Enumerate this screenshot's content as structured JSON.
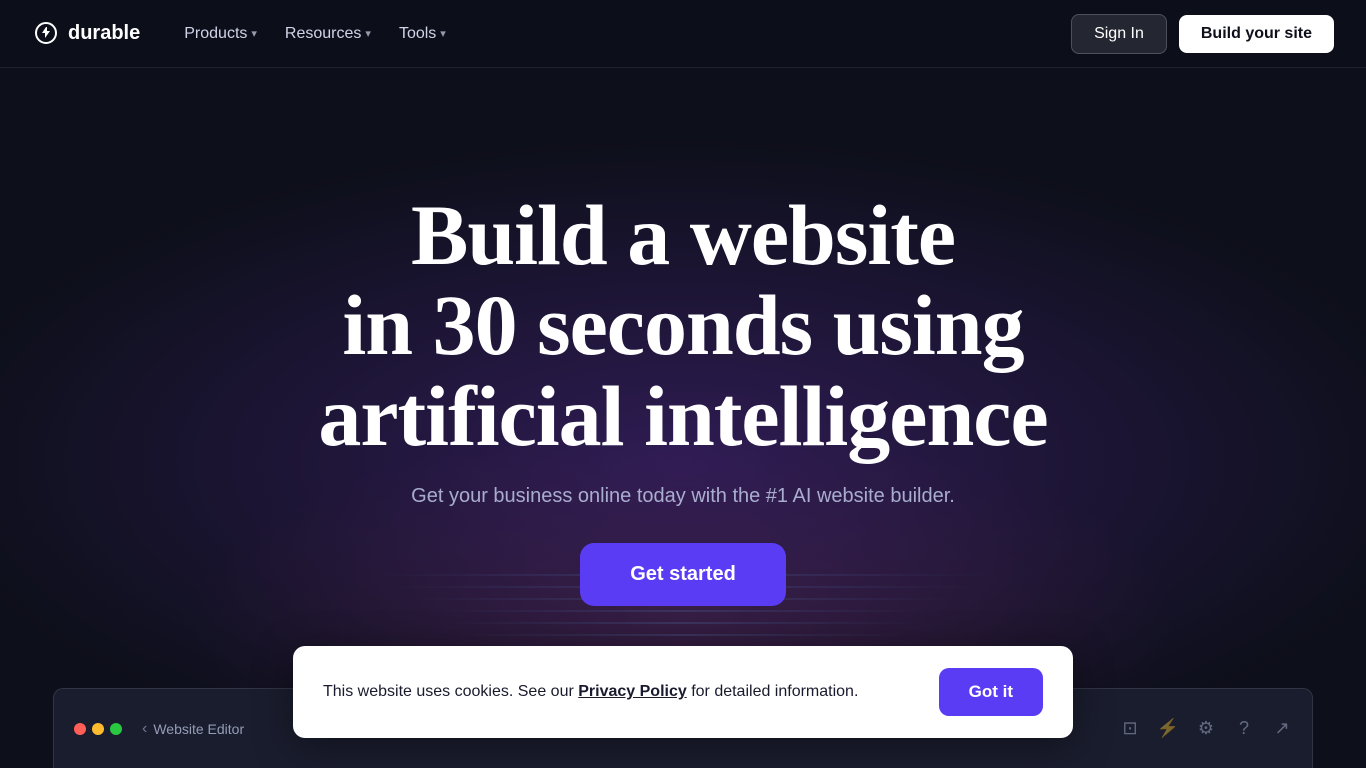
{
  "nav": {
    "logo_text": "durable",
    "menu_items": [
      {
        "label": "Products",
        "has_chevron": true
      },
      {
        "label": "Resources",
        "has_chevron": true
      },
      {
        "label": "Tools",
        "has_chevron": true
      }
    ],
    "signin_label": "Sign In",
    "build_label": "Build your site"
  },
  "hero": {
    "title_line1": "Build a website",
    "title_line2": "in 30 seconds using",
    "title_line3": "artificial intelligence",
    "subtitle": "Get your business online today with the #1 AI website builder.",
    "cta_label": "Get started"
  },
  "editor": {
    "label": "Website Editor",
    "back_icon": "chevron-left",
    "icons": [
      "monitor-icon",
      "lightning-icon",
      "gear-icon",
      "help-icon",
      "external-link-icon"
    ]
  },
  "cookie": {
    "message_before": "This website uses cookies. See our ",
    "privacy_text": "Privacy Policy",
    "message_after": " for detailed information.",
    "button_label": "Got it"
  }
}
